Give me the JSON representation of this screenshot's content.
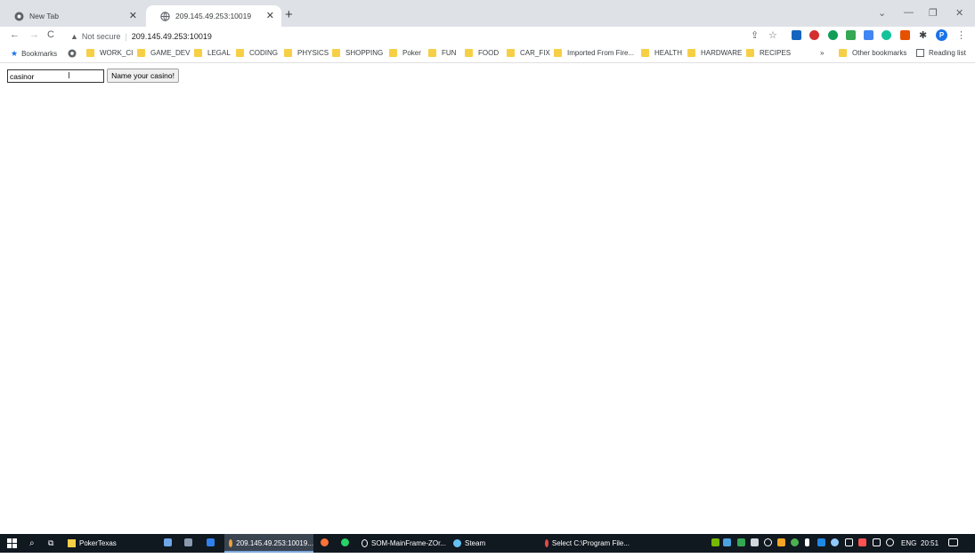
{
  "browser": {
    "tabs": [
      {
        "label": "New Tab",
        "active": false
      },
      {
        "label": "209.145.49.253:10019",
        "active": true
      }
    ],
    "address": {
      "security_label": "Not secure",
      "url": "209.145.49.253:10019"
    },
    "bookmarks": {
      "first": "Bookmarks",
      "folders": [
        "WORK_CI",
        "GAME_DEV",
        "LEGAL",
        "CODING",
        "PHYSICS",
        "SHOPPING",
        "Poker",
        "FUN",
        "FOOD",
        "CAR_FIX",
        "Imported From Fire...",
        "HEALTH",
        "HARDWARE",
        "RECIPES"
      ],
      "overflow": "»",
      "other": "Other bookmarks",
      "reading_list": "Reading list"
    },
    "profile_initial": "P"
  },
  "page": {
    "name_input_value": "casinor",
    "name_button_label": "Name your casino!"
  },
  "taskbar": {
    "items": [
      "PokerTexas",
      "209.145.49.253:10019...",
      "SOM-MainFrame-ZOr...",
      "Steam",
      "Select C:\\Program File..."
    ],
    "language": "ENG",
    "time": "20:51"
  },
  "colors": {
    "tabstrip": "#dee1e6",
    "folder": "#f7cf46",
    "taskbar": "#101820",
    "accent": "#1a73e8"
  }
}
